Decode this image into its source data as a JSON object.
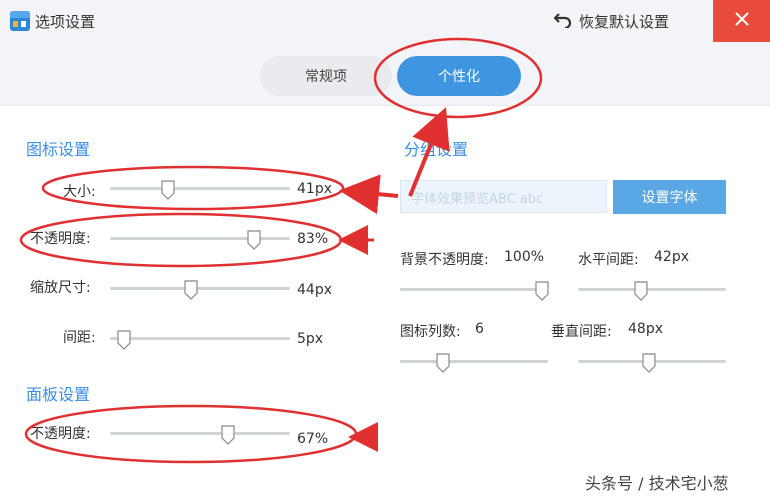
{
  "window": {
    "title": "选项设置",
    "restore_label": "恢复默认设置",
    "close_icon": "close-icon",
    "accent_color": "#3e96e0",
    "close_color": "#e84a3b"
  },
  "tabs": [
    {
      "label": "常规项",
      "active": false
    },
    {
      "label": "个性化",
      "active": true
    }
  ],
  "icon_settings": {
    "title": "图标设置",
    "size": {
      "label": "大小:",
      "value": "41px",
      "level": 0.31
    },
    "opacity": {
      "label": "不透明度:",
      "value": "83%",
      "level": 0.8
    },
    "zoom": {
      "label": "缩放尺寸:",
      "value": "44px",
      "level": 0.44
    },
    "spacing": {
      "label": "间距:",
      "value": "5px",
      "level": 0.05
    }
  },
  "panel_settings": {
    "title": "面板设置",
    "opacity": {
      "label": "不透明度:",
      "value": "67%",
      "level": 0.67
    }
  },
  "group_settings": {
    "title": "分组设置",
    "font_preview": "字体效果预览ABC abc",
    "font_button": "设置字体",
    "bg_opacity": {
      "label": "背景不透明度:",
      "value": "100%",
      "level": 1.0
    },
    "h_spacing": {
      "label": "水平间距:",
      "value": "42px",
      "level": 0.42
    },
    "icon_columns": {
      "label": "图标列数:",
      "value": "6",
      "level": 0.3
    },
    "v_spacing": {
      "label": "垂直间距:",
      "value": "48px",
      "level": 0.48
    }
  },
  "watermark": "头条号 / 技术宅小葱"
}
